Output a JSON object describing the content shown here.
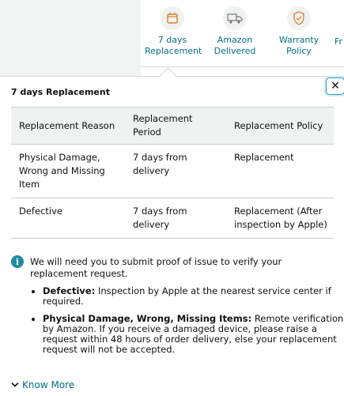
{
  "features": [
    {
      "label_line1": "7 days",
      "label_line2": "Replacement",
      "icon": "replacement-icon"
    },
    {
      "label_line1": "Amazon",
      "label_line2": "Delivered",
      "icon": "delivery-truck-icon"
    },
    {
      "label_line1": "Warranty Policy",
      "label_line2": "",
      "icon": "warranty-shield-icon"
    },
    {
      "label_line1": "Fr",
      "label_line2": "",
      "icon": ""
    }
  ],
  "popover": {
    "title": "7 days Replacement",
    "close_label": "✕"
  },
  "table": {
    "headers": [
      "Replacement Reason",
      "Replacement Period",
      "Replacement Policy"
    ],
    "rows": [
      [
        "Physical Damage, Wrong and Missing Item",
        "7 days from delivery",
        "Replacement"
      ],
      [
        "Defective",
        "7 days from delivery",
        "Replacement (After inspection by Apple)"
      ]
    ]
  },
  "note": {
    "text": "We will need you to submit proof of issue to verify your replacement request.",
    "items": [
      {
        "bold": "Defective:",
        "text": " Inspection by Apple at the nearest service center if required."
      },
      {
        "bold": "Physical Damage, Wrong, Missing Items:",
        "text": " Remote verification by Amazon. If you receive a damaged device, please raise a request within 48 hours of order delivery, else your replacement request will not be accepted."
      }
    ]
  },
  "know_more": "Know More",
  "colors": {
    "link": "#007185",
    "info": "#1f8aa0"
  }
}
